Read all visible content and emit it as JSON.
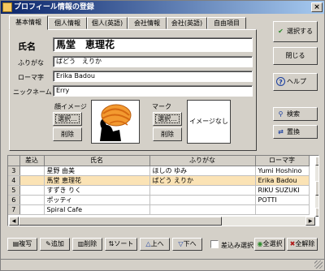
{
  "window": {
    "title": "プロフィール情報の登録",
    "close": "×"
  },
  "tabs": [
    "基本情報",
    "個人情報",
    "個人(英語)",
    "会社情報",
    "会社(英語)",
    "自由項目"
  ],
  "form": {
    "name_label": "氏名",
    "name_value": "馬堂　恵理花",
    "furigana_label": "ふりがな",
    "furigana_value": "ばどう　えりか",
    "romaji_label": "ローマ字",
    "romaji_value": "Erika Badou",
    "nickname_label": "ニックネーム",
    "nickname_value": "Erry",
    "face_label": "顔イメージ",
    "mark_label": "マーク",
    "select_label": "選択...",
    "delete_label": "削除",
    "no_image_label": "イメージなし"
  },
  "side_buttons": {
    "select": "選択する",
    "close": "閉じる",
    "help": "ヘルプ",
    "search": "検索",
    "replace": "置換"
  },
  "grid": {
    "headers": [
      "",
      "差込",
      "氏名",
      "ふりがな",
      "ローマ字"
    ],
    "rows": [
      {
        "idx": "3",
        "insert": "",
        "name": "星野 由美",
        "furigana": "ほしの ゆみ",
        "romaji": "Yumi Hoshino"
      },
      {
        "idx": "4",
        "insert": "",
        "name": "馬堂 恵理花",
        "furigana": "ばどう えりか",
        "romaji": "Erika Badou"
      },
      {
        "idx": "5",
        "insert": "",
        "name": "すずき りく",
        "furigana": "",
        "romaji": "RIKU SUZUKI"
      },
      {
        "idx": "6",
        "insert": "",
        "name": "ポッティ",
        "furigana": "",
        "romaji": "POTTI"
      },
      {
        "idx": "7",
        "insert": "",
        "name": "Spiral Cafe",
        "furigana": "",
        "romaji": ""
      }
    ]
  },
  "bottom": {
    "copy": "複写",
    "add": "追加",
    "delete": "削除",
    "sort": "ソート",
    "up": "上へ",
    "down": "下へ",
    "insert_select": "差込み選択",
    "select_all": "全選択",
    "clear_all": "全解除"
  },
  "colors": {
    "title_bar": "#0a246a",
    "selected_row": "#fbe3b5",
    "face": "#f39a30"
  }
}
